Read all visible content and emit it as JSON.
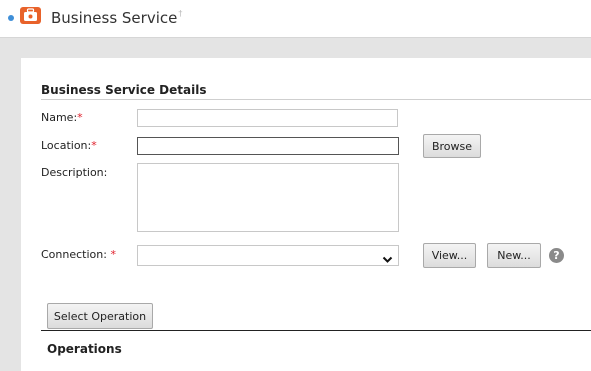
{
  "header": {
    "title": "Business Service",
    "title_sup": "†",
    "icon": "toolbox-icon",
    "accent_color": "#e8622a",
    "status_dot_color": "#3f8fd8"
  },
  "details": {
    "section_title": "Business Service Details",
    "name_label": "Name:",
    "location_label": "Location:",
    "description_label": "Description:",
    "connection_label": "Connection:",
    "required_marker": "*",
    "name_value": "",
    "location_value": "",
    "description_value": "",
    "connection_value": "",
    "browse_label": "Browse",
    "view_label": "View...",
    "new_label": "New...",
    "help_symbol": "?"
  },
  "operations": {
    "select_button_label": "Select Operation",
    "section_title": "Operations"
  }
}
